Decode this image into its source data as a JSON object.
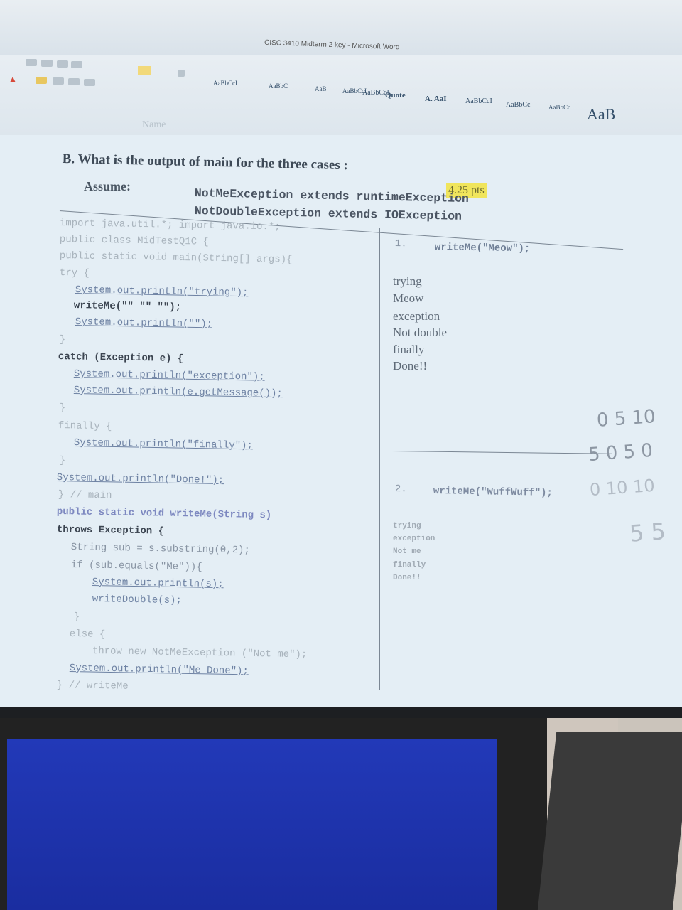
{
  "window": {
    "title": "CISC 3410 Midterm 2 key - Microsoft Word"
  },
  "ribbon": {
    "styles": [
      "AaBbCcI",
      "AaBbC",
      "AaB",
      "AaBbCcI",
      "AaBbCcI",
      "Quote",
      "A. AaI",
      "AaBbCcI",
      "AaBbCc",
      "AaBbCc",
      "AaB"
    ]
  },
  "document": {
    "name_field": "Name",
    "heading": "B. What is the output of main for the three cases :",
    "points": "4.25 pts",
    "assume_label": "Assume:",
    "assume_lines": [
      "NotMeException extends runtimeException",
      "NotDoubleException extends IOException"
    ],
    "code": [
      "import java.util.*; import java.io.*;",
      "public class MidTestQ1C {",
      "public static void main(String[] args){",
      "try {",
      "System.out.println(\"trying\");",
      "writeMe(\"\" \"\" \"\");",
      "System.out.println(\"\");",
      "}",
      "catch (Exception e) {",
      "System.out.println(\"exception\");",
      "System.out.println(e.getMessage());",
      "}",
      "finally {",
      "System.out.println(\"finally\");",
      "}",
      "System.out.println(\"Done!\");",
      "} // main",
      "public static void writeMe(String s)",
      "throws Exception {",
      "String sub = s.substring(0,2);",
      "if (sub.equals(\"Me\")){",
      "System.out.println(s);",
      "writeDouble(s);",
      "}",
      "else {",
      "throw new NotMeException (\"Not me\");",
      "System.out.println(\"Me Done\");",
      "} // writeMe"
    ],
    "case1": {
      "number": "1.",
      "call": "writeMe(\"Meow\");",
      "output": [
        "trying",
        "Meow",
        "exception",
        "Not double",
        "finally",
        "Done!!"
      ]
    },
    "case2": {
      "number": "2.",
      "call": "writeMe(\"WuffWuff\");",
      "output": [
        "trying",
        "exception",
        "Not me",
        "finally",
        "Done!!"
      ]
    },
    "handwritten": {
      "row1": "0 5 10",
      "row2": "5 0 5 0",
      "row3": "0 10 10",
      "row4": "5 5"
    }
  }
}
